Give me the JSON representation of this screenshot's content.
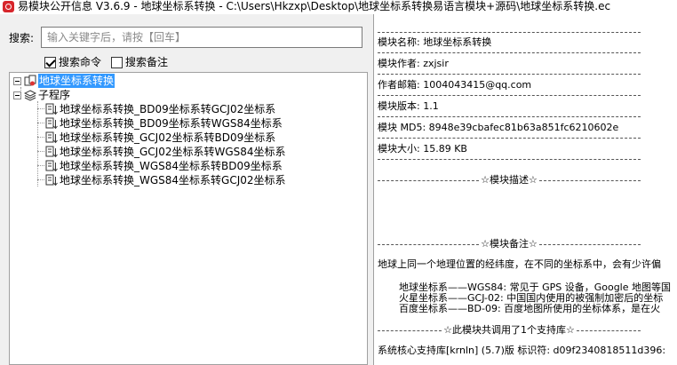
{
  "window": {
    "title": "易模块公开信息 V3.6.9 - 地球坐标系转换 - C:\\Users\\Hkzxp\\Desktop\\地球坐标系转换易语言模块+源码\\地球坐标系转换.ec",
    "icon": "app-icon"
  },
  "search": {
    "label": "搜索:",
    "placeholder": "输入关键字后，请按【回车】",
    "value": "",
    "opt_commands_label": "搜索命令",
    "opt_commands_checked": true,
    "opt_notes_label": "搜索备注",
    "opt_notes_checked": false
  },
  "tree": {
    "root": "地球坐标系转换",
    "group": "子程序",
    "items": [
      "地球坐标系转换_BD09坐标系转GCJ02坐标系",
      "地球坐标系转换_BD09坐标系转WGS84坐标系",
      "地球坐标系转换_GCJ02坐标系转BD09坐标系",
      "地球坐标系转换_GCJ02坐标系转WGS84坐标系",
      "地球坐标系转换_WGS84坐标系转BD09坐标系",
      "地球坐标系转换_WGS84坐标系转GCJ02坐标系"
    ]
  },
  "info": {
    "name": "模块名称: 地球坐标系转换",
    "author": "模块作者: zxjsir",
    "email": "作者邮箱: 1004043415@qq.com",
    "version": "模块版本: 1.1",
    "md5": "模块 MD5: 8948e39cbafec81b63a851fc6210602e",
    "size": "模块大小: 15.89 KB",
    "desc_header": "☆模块描述☆",
    "notes_header": "☆模块备注☆",
    "notes_intro": "地球上同一个地理位置的经纬度，在不同的坐标系中，会有少许偏",
    "notes_wgs": "地球坐标系——WGS84: 常见于 GPS 设备，Google 地图等国",
    "notes_gcj": "火星坐标系——GCJ-02: 中国国内使用的被强制加密后的坐标",
    "notes_bd": "百度坐标系——BD-09: 百度地图所使用的坐标体系，是在火",
    "lib_header": "☆此模块共调用了1个支持库☆",
    "lib_line": "系统核心支持库[krnln]  (5.7)版  标识符: d09f2340818511d396:"
  }
}
